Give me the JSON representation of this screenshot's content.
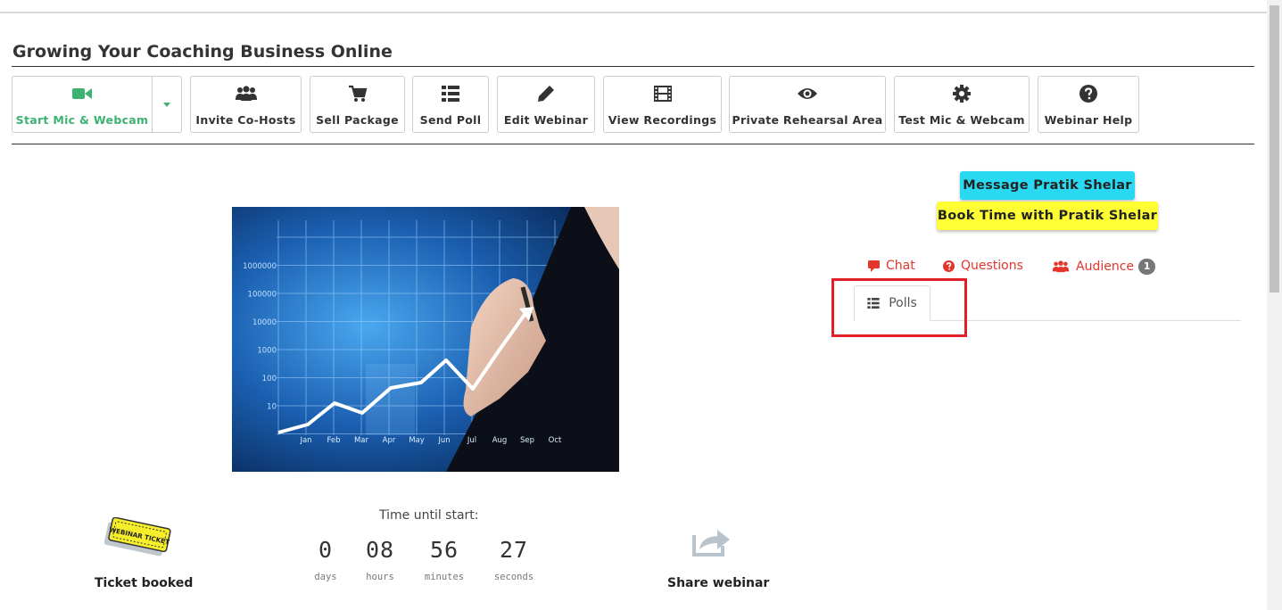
{
  "page": {
    "title": "Growing Your Coaching Business Online"
  },
  "toolbar": {
    "start_mic": "Start Mic & Webcam",
    "invite": "Invite Co-Hosts",
    "sell": "Sell Package",
    "poll": "Send Poll",
    "edit": "Edit Webinar",
    "recordings": "View Recordings",
    "rehearsal": "Private Rehearsal Area",
    "test": "Test Mic & Webcam",
    "help": "Webinar Help"
  },
  "actions": {
    "message": "Message Pratik Shelar",
    "book": "Book Time with Pratik Shelar"
  },
  "tabs": {
    "chat": "Chat",
    "questions": "Questions",
    "audience": "Audience",
    "audience_count": "1",
    "polls": "Polls"
  },
  "hero": {
    "y_ticks": [
      "1000000",
      "100000",
      "10000",
      "1000",
      "100",
      "10"
    ],
    "months": [
      "Jan",
      "Feb",
      "Mar",
      "Apr",
      "May",
      "Jun",
      "Jul",
      "Aug",
      "Sep",
      "Oct"
    ]
  },
  "ticket": {
    "label": "Ticket booked",
    "stamp": "WEBINAR TICKET"
  },
  "countdown": {
    "title": "Time until start:",
    "days": "0",
    "hours": "08",
    "minutes": "56",
    "seconds": "27",
    "days_label": "days",
    "hours_label": "hours",
    "minutes_label": "minutes",
    "seconds_label": "seconds"
  },
  "share": {
    "label": "Share webinar"
  },
  "colors": {
    "accent_green": "#3cb371",
    "tab_red": "#e3352b",
    "message_btn": "#29d9f2",
    "book_btn": "#ffff33",
    "highlight_box": "#e32028"
  }
}
